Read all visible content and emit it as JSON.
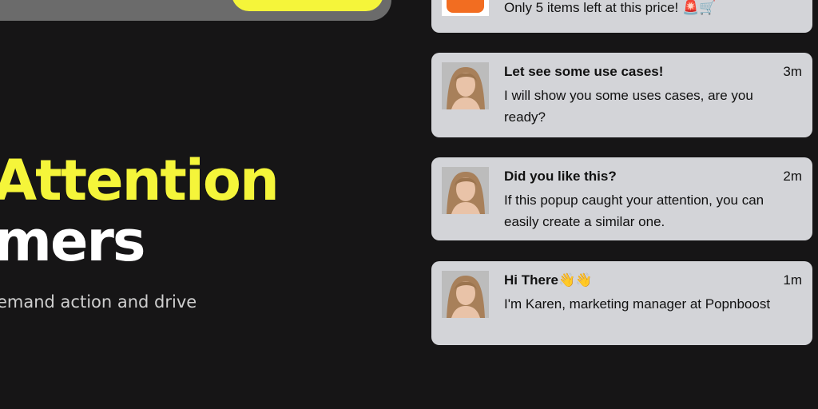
{
  "hero": {
    "line1": "Attention",
    "line2": "mers",
    "subtitle": "emand action and drive"
  },
  "notifications": [
    {
      "body": "Only 5 items left at this price! 🚨🛒",
      "avatar": "shop-logo-icon"
    },
    {
      "title": "Let see some use cases!",
      "time": "3m",
      "body": "I will show you some uses cases, are you ready?",
      "avatar": "avatar-karen"
    },
    {
      "title": "Did you like this?",
      "time": "2m",
      "body": "If this popup caught your attention, you can easily create a similar one.",
      "avatar": "avatar-karen"
    },
    {
      "title": "Hi There👋👋",
      "time": "1m",
      "body": "I'm Karen, marketing manager at Popnboost",
      "avatar": "avatar-karen"
    }
  ],
  "colors": {
    "background": "#161516",
    "accent": "#f5f53a",
    "card": "#d3d4d8",
    "shop_brand": "#f26d21"
  }
}
